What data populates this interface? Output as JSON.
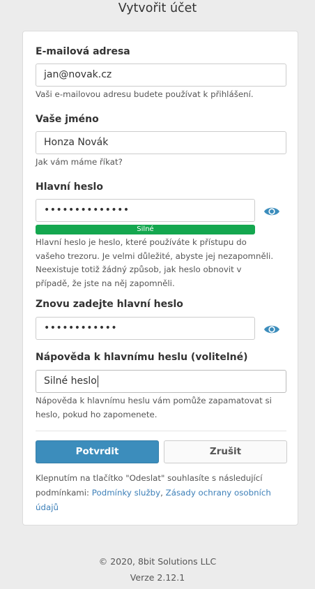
{
  "page": {
    "title": "Vytvořit účet"
  },
  "form": {
    "email": {
      "label": "E-mailová adresa",
      "value": "jan@novak.cz",
      "hint": "Vaši e-mailovou adresu budete používat k přihlášení."
    },
    "name": {
      "label": "Vaše jméno",
      "value": "Honza Novák",
      "hint": "Jak vám máme říkat?"
    },
    "master_password": {
      "label": "Hlavní heslo",
      "value": "••••••••••••••",
      "strength_label": "Silné",
      "hint": "Hlavní heslo je heslo, které používáte k přístupu do vašeho trezoru. Je velmi důležité, abyste jej nezapomněli. Neexistuje totiž žádný způsob, jak heslo obnovit v případě, že jste na něj zapomněli."
    },
    "confirm_password": {
      "label": "Znovu zadejte hlavní heslo",
      "value": "••••••••••••"
    },
    "password_hint": {
      "label": "Nápověda k hlavnímu heslu (volitelné)",
      "value": "Silné heslo",
      "hint": "Nápověda k hlavnímu heslu vám pomůže zapamatovat si heslo, pokud ho zapomenete."
    },
    "buttons": {
      "submit": "Potvrdit",
      "cancel": "Zrušit"
    },
    "terms": {
      "text": "Klepnutím na tlačítko \"Odeslat\" souhlasíte s následující podmínkami: ",
      "link_tos": "Podmínky služby",
      "separator": ", ",
      "link_privacy": "Zásady ochrany osobních údajů"
    }
  },
  "footer": {
    "copyright": "© 2020, 8bit Solutions LLC",
    "version": "Verze 2.12.1"
  },
  "colors": {
    "accent": "#3c8dbc",
    "strength": "#14a74f",
    "link": "#3c7fb8"
  },
  "icons": {
    "toggle_visibility": "eye-icon"
  }
}
